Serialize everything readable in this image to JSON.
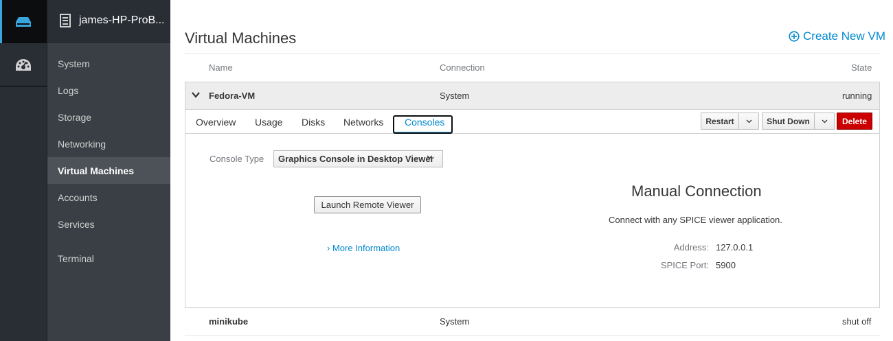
{
  "rail": {
    "items": [
      {
        "icon": "server-icon",
        "active": true
      },
      {
        "icon": "dashboard-icon",
        "active": false
      }
    ]
  },
  "sidebar": {
    "host_name": "james-HP-ProB...",
    "items": [
      {
        "label": "System"
      },
      {
        "label": "Logs"
      },
      {
        "label": "Storage"
      },
      {
        "label": "Networking"
      },
      {
        "label": "Virtual Machines",
        "active": true
      },
      {
        "label": "Accounts"
      },
      {
        "label": "Services"
      },
      {
        "label": "Terminal"
      }
    ]
  },
  "main": {
    "title": "Virtual Machines",
    "create_label": "Create New VM",
    "columns": {
      "name": "Name",
      "connection": "Connection",
      "state": "State"
    },
    "vms": [
      {
        "name": "Fedora-VM",
        "connection": "System",
        "state": "running",
        "expanded": true,
        "tabs": [
          "Overview",
          "Usage",
          "Disks",
          "Networks",
          "Consoles"
        ],
        "active_tab": "Consoles",
        "actions": {
          "restart": "Restart",
          "shutdown": "Shut Down",
          "delete": "Delete"
        },
        "console": {
          "type_label": "Console Type",
          "type_value": "Graphics Console in Desktop Viewer",
          "launch_label": "Launch Remote Viewer",
          "more_info": "More Information",
          "manual_title": "Manual Connection",
          "manual_desc": "Connect with any SPICE viewer application.",
          "address_label": "Address:",
          "address_value": "127.0.0.1",
          "port_label": "SPICE Port:",
          "port_value": "5900"
        }
      },
      {
        "name": "minikube",
        "connection": "System",
        "state": "shut off",
        "expanded": false
      }
    ]
  },
  "colors": {
    "accent": "#0088ce",
    "danger": "#cc0000",
    "rail_bg": "#292e34",
    "sidebar_bg": "#393f44"
  }
}
